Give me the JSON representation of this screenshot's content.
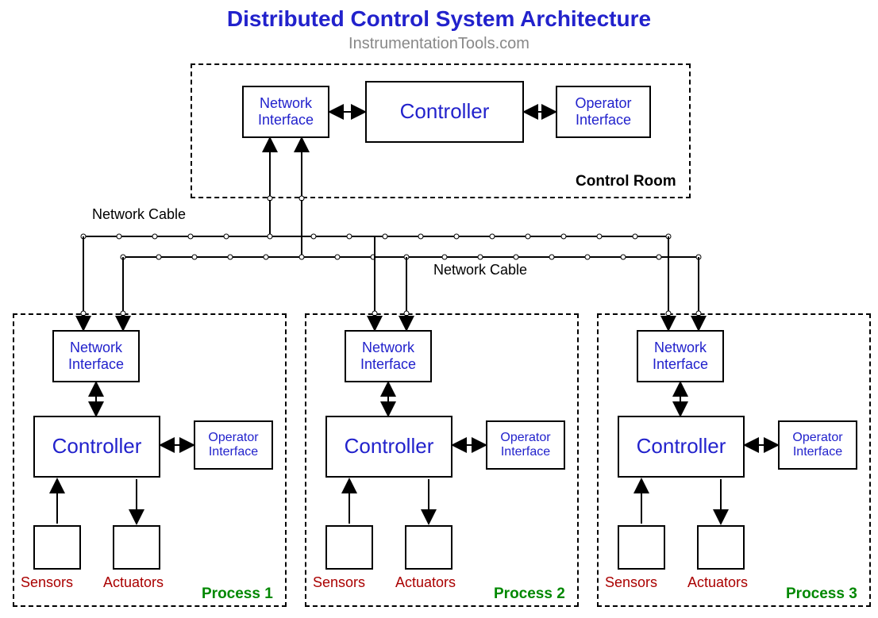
{
  "title": "Distributed Control System Architecture",
  "subtitle": "InstrumentationTools.com",
  "controlRoom": {
    "label": "Control Room",
    "networkInterface": "Network\nInterface",
    "controller": "Controller",
    "operatorInterface": "Operator\nInterface"
  },
  "networkCable1": "Network Cable",
  "networkCable2": "Network Cable",
  "processes": [
    {
      "label": "Process 1",
      "networkInterface": "Network\nInterface",
      "controller": "Controller",
      "operatorInterface": "Operator\nInterface",
      "sensors": "Sensors",
      "actuators": "Actuators"
    },
    {
      "label": "Process 2",
      "networkInterface": "Network\nInterface",
      "controller": "Controller",
      "operatorInterface": "Operator\nInterface",
      "sensors": "Sensors",
      "actuators": "Actuators"
    },
    {
      "label": "Process 3",
      "networkInterface": "Network\nInterface",
      "controller": "Controller",
      "operatorInterface": "Operator\nInterface",
      "sensors": "Sensors",
      "actuators": "Actuators"
    }
  ]
}
